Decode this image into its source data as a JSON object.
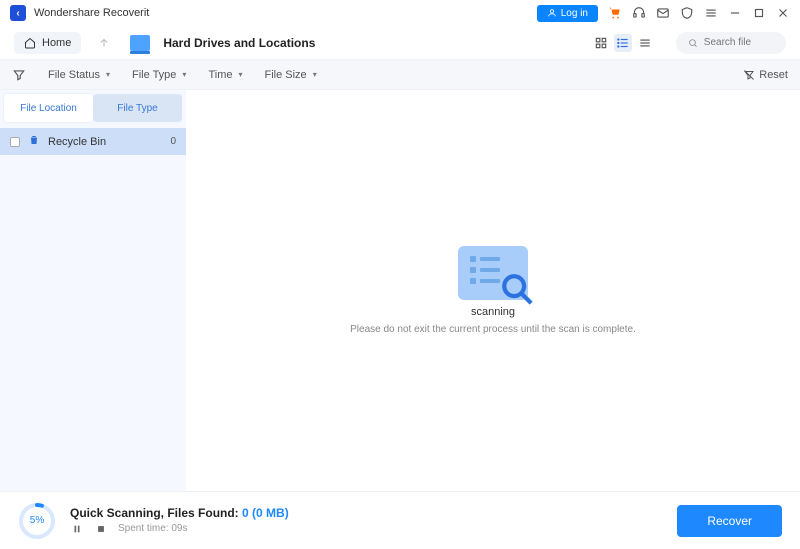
{
  "app": {
    "title": "Wondershare Recoverit"
  },
  "titlebar": {
    "login_label": "Log in"
  },
  "nav": {
    "home_label": "Home",
    "location_title": "Hard Drives and Locations",
    "search_placeholder": "Search file"
  },
  "filter": {
    "status": "File Status",
    "type": "File Type",
    "time": "Time",
    "size": "File Size",
    "reset": "Reset"
  },
  "sidebar": {
    "tabs": {
      "location": "File Location",
      "type": "File Type"
    },
    "items": [
      {
        "label": "Recycle Bin",
        "count": "0"
      }
    ]
  },
  "content": {
    "scanning_label": "scanning",
    "scanning_msg": "Please do not exit the current process until the scan is complete."
  },
  "footer": {
    "progress_pct": "5%",
    "line_prefix": "Quick Scanning, Files Found: ",
    "files_found": "0",
    "files_size": " (0 MB)",
    "spent_label": "Spent time: 09s",
    "recover_label": "Recover"
  }
}
